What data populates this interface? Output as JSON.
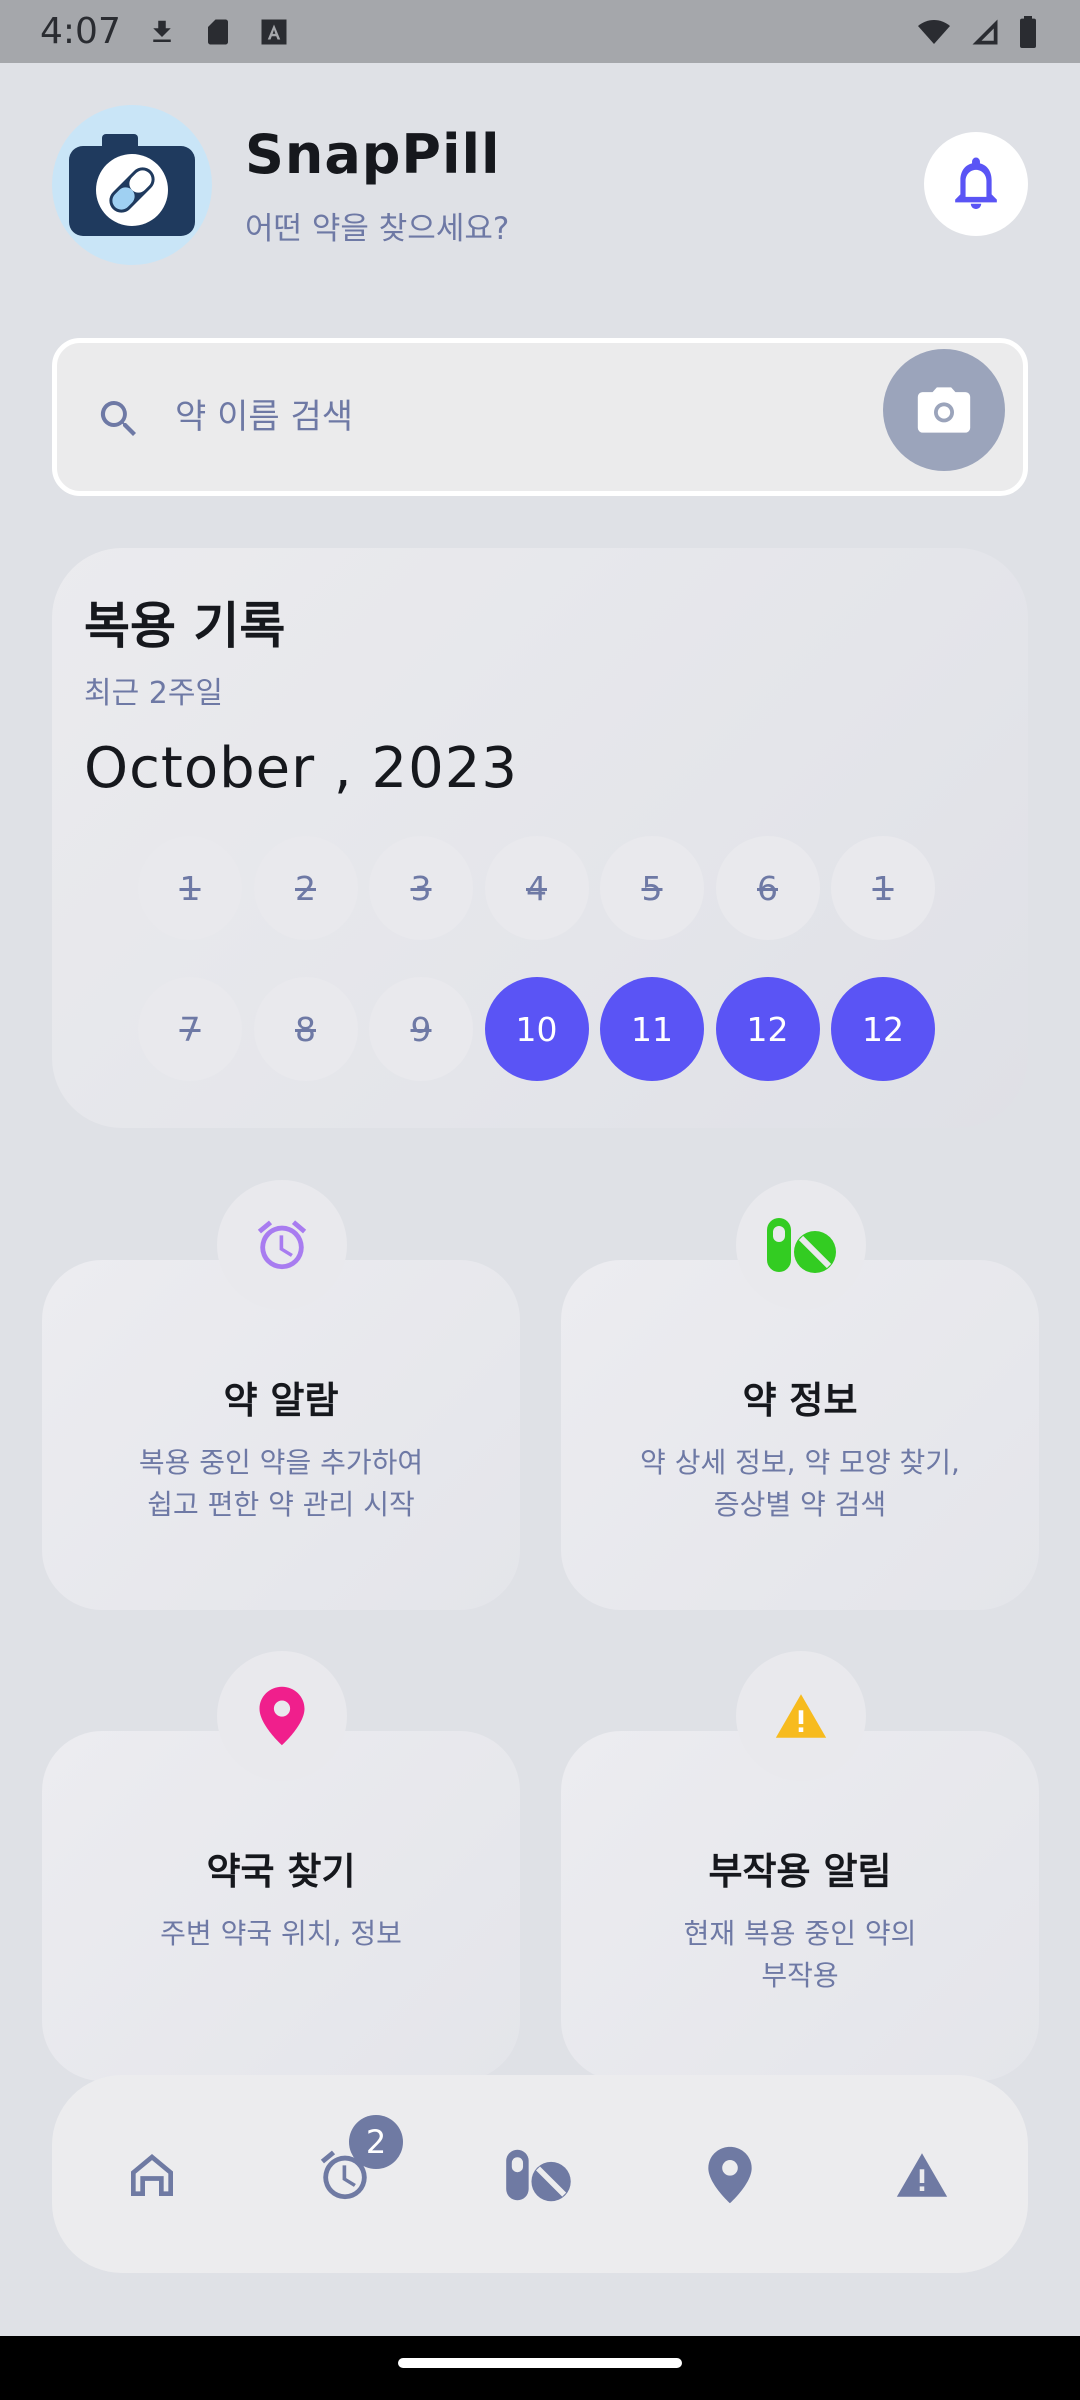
{
  "status_bar": {
    "time": "4:07"
  },
  "header": {
    "title": "SnapPill",
    "subtitle": "어떤 약을 찾으세요?"
  },
  "search": {
    "placeholder": "약 이름 검색"
  },
  "record": {
    "title": "복용 기록",
    "subtitle": "최근 2주일",
    "month": "October , 2023",
    "days": [
      {
        "label": "1",
        "state": "done"
      },
      {
        "label": "2",
        "state": "done"
      },
      {
        "label": "3",
        "state": "done"
      },
      {
        "label": "4",
        "state": "done"
      },
      {
        "label": "5",
        "state": "done"
      },
      {
        "label": "6",
        "state": "done"
      },
      {
        "label": "1",
        "state": "done"
      },
      {
        "label": "7",
        "state": "done"
      },
      {
        "label": "8",
        "state": "done"
      },
      {
        "label": "9",
        "state": "done"
      },
      {
        "label": "10",
        "state": "active"
      },
      {
        "label": "11",
        "state": "active"
      },
      {
        "label": "12",
        "state": "active"
      },
      {
        "label": "12",
        "state": "active"
      }
    ]
  },
  "features": [
    {
      "title": "약 알람",
      "desc": "복용 중인 약을 추가하여\n쉽고 편한 약 관리 시작",
      "icon": "alarm-icon",
      "color": "#a87cf0"
    },
    {
      "title": "약 정보",
      "desc": "약 상세 정보, 약 모양 찾기,\n증상별 약 검색",
      "icon": "pills-icon",
      "color": "#33cc22"
    },
    {
      "title": "약국 찾기",
      "desc": "주변 약국 위치, 정보",
      "icon": "location-pin-icon",
      "color": "#f01f8c"
    },
    {
      "title": "부작용 알림",
      "desc": "현재 복용 중인 약의\n부작용",
      "icon": "warning-icon",
      "color": "#f7bb1e"
    }
  ],
  "bottom_nav": {
    "items": [
      "home-icon",
      "alarm-icon",
      "pills-icon",
      "location-pin-icon",
      "warning-icon"
    ],
    "alarm_badge": "2"
  },
  "colors": {
    "accent": "#5a54f5",
    "muted": "#6e79a5",
    "nav_icon": "#6f7aa3"
  }
}
